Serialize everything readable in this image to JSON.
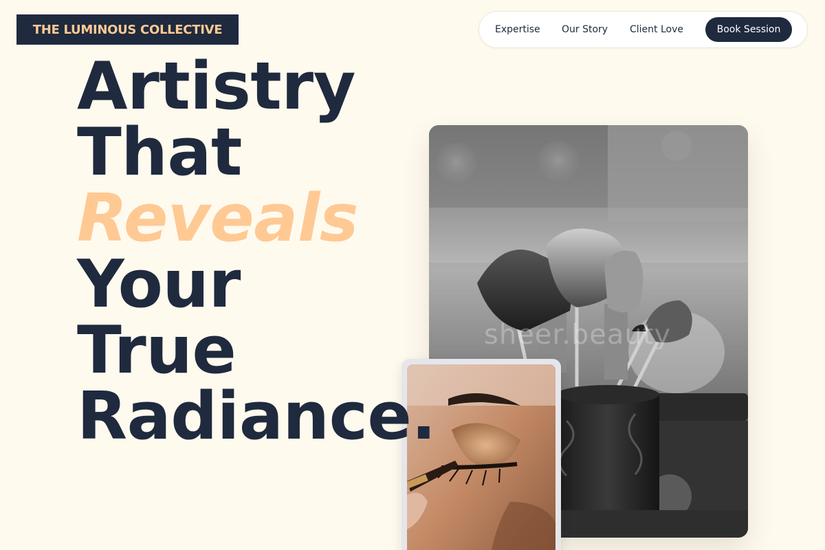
{
  "brand": {
    "name": "THE LUMINOUS COLLECTIVE"
  },
  "nav": {
    "links": [
      {
        "label": "Expertise"
      },
      {
        "label": "Our Story"
      },
      {
        "label": "Client Love"
      }
    ],
    "cta": "Book Session"
  },
  "hero": {
    "headline_lines": [
      "Artistry",
      "That",
      "Reveals",
      "Your",
      "True",
      "Radiance."
    ]
  },
  "images": {
    "main_watermark": "sheer.beauty"
  },
  "colors": {
    "background": "#fffaee",
    "navy": "#1f2a3e",
    "accent": "#ffc994"
  }
}
